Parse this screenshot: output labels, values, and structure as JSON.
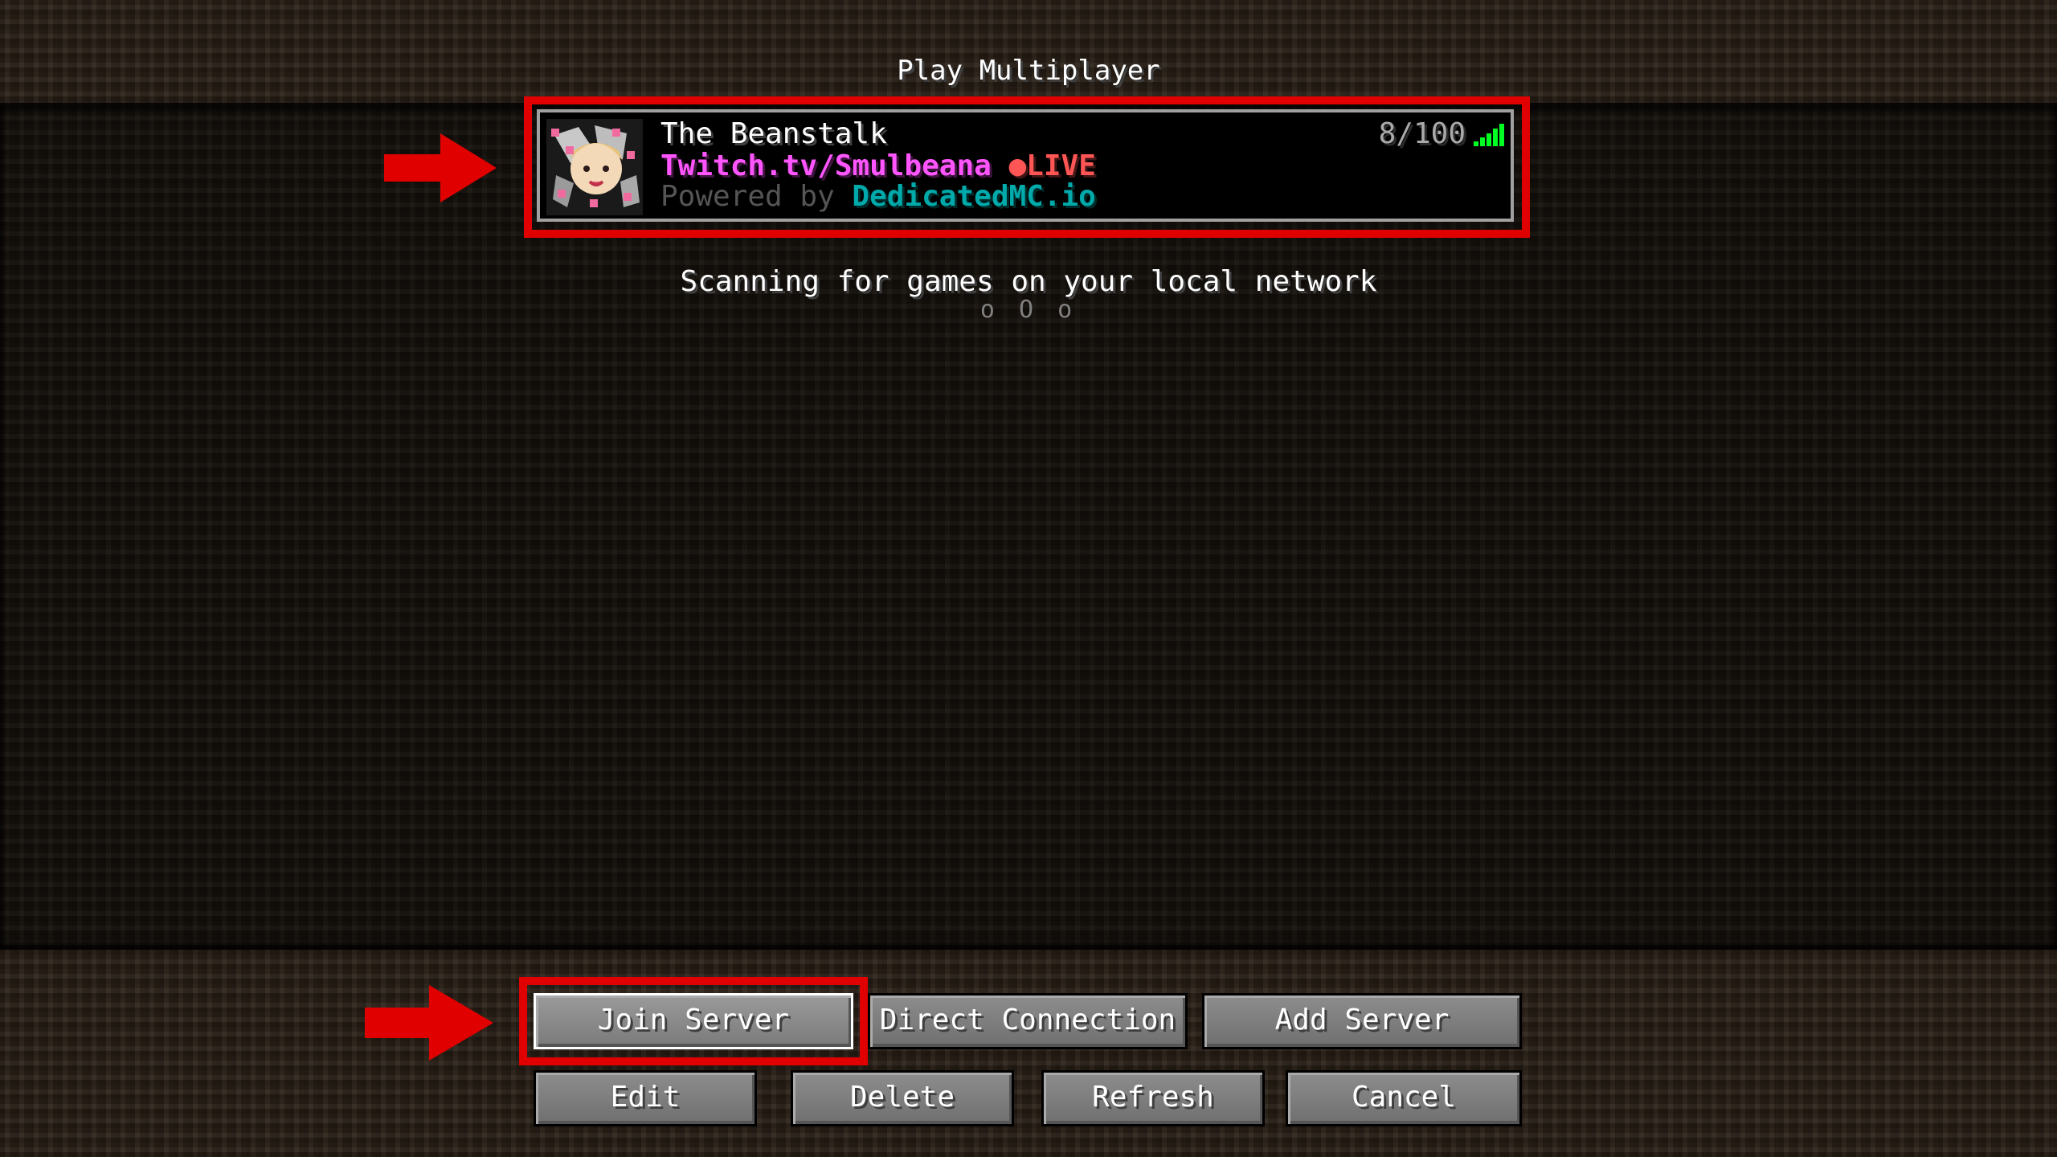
{
  "screen": {
    "title": "Play Multiplayer"
  },
  "server": {
    "name": "The Beanstalk",
    "motd_twitch": "Twitch.tv/Smulbeana",
    "motd_live": "●LIVE",
    "motd_powered_by": "Powered by ",
    "motd_host": "DedicatedMC.io",
    "players": "8/100",
    "icon": "server-avatar-icon",
    "signal_icon": "signal-strength-icon"
  },
  "scan": {
    "text": "Scanning for games on your local network",
    "dots": "o O o"
  },
  "buttons": {
    "join": "Join Server",
    "direct": "Direct Connection",
    "add": "Add Server",
    "edit": "Edit",
    "delete": "Delete",
    "refresh": "Refresh",
    "cancel": "Cancel"
  },
  "annotations": {
    "highlight_color": "#e00000",
    "arrow_icon": "red-arrow-icon"
  }
}
